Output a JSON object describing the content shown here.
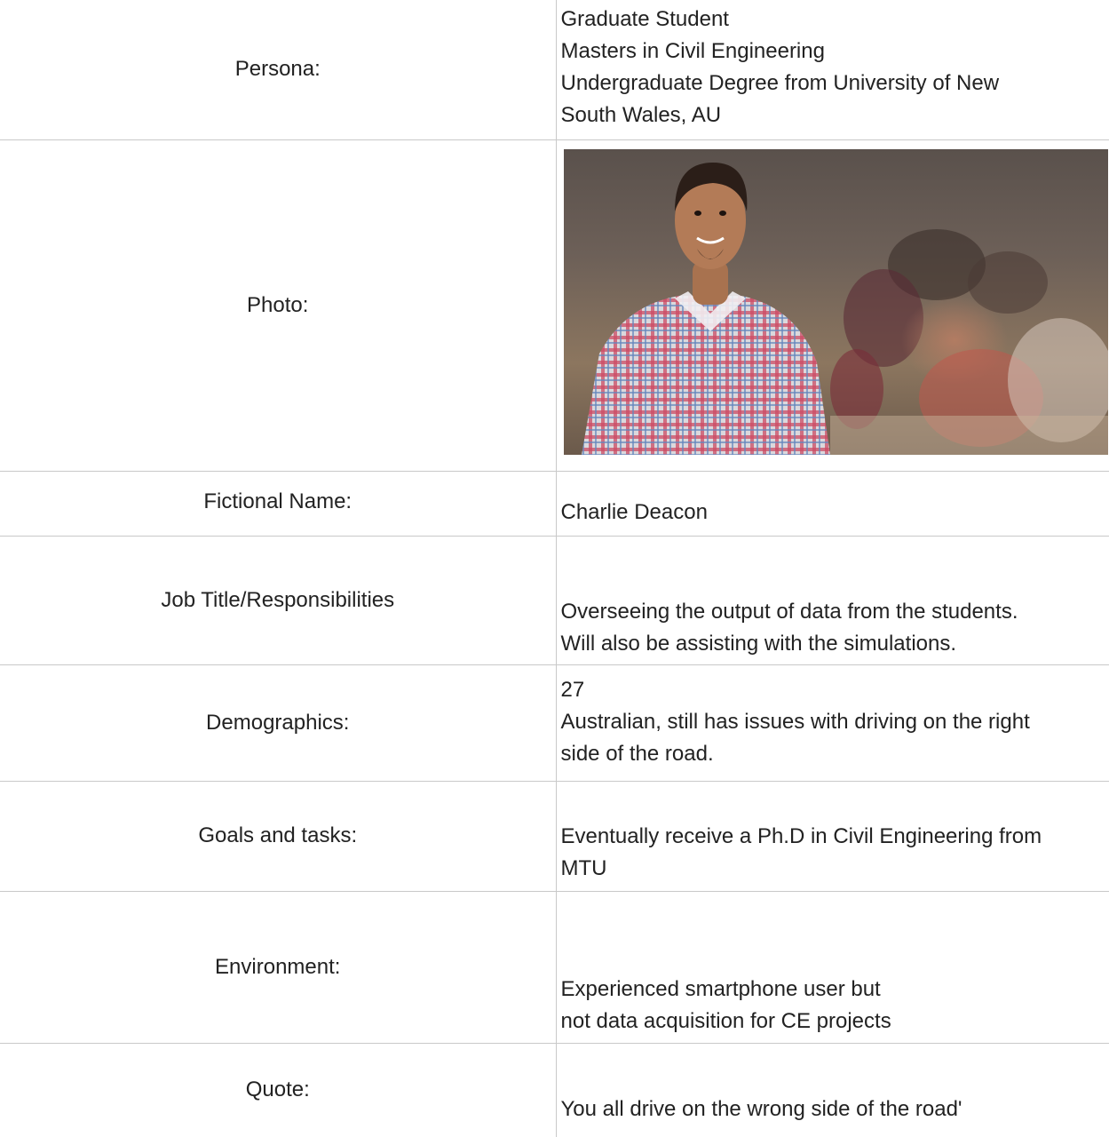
{
  "rows": [
    {
      "label": "Persona:",
      "lines": [
        "Graduate Student",
        "Masters in Civil Engineering",
        "Undergraduate Degree from University of New",
        "South Wales, AU"
      ]
    },
    {
      "label": "Photo:",
      "photo": {
        "icon": "person-photo",
        "bg": "#5b524d",
        "shirt_red": "#d9506a",
        "shirt_blue": "#6b8fc9"
      }
    },
    {
      "label": "Fictional Name:",
      "lines": [
        "Charlie Deacon"
      ]
    },
    {
      "label": "Job Title/Responsibilities",
      "lines": [
        "Overseeing the output of data from the students.",
        "Will also be assisting with the simulations."
      ]
    },
    {
      "label": "Demographics:",
      "lines": [
        "27",
        "Australian, still has issues with driving on the right",
        "side of the road."
      ]
    },
    {
      "label": "Goals and tasks:",
      "lines": [
        "Eventually receive a Ph.D in Civil Engineering from",
        "MTU"
      ]
    },
    {
      "label": "Environment:",
      "lines": [
        "Experienced smartphone user but",
        "not data acquisition for CE projects"
      ]
    },
    {
      "label": "Quote:",
      "lines": [
        "You all drive on the wrong side of the road'"
      ]
    }
  ],
  "colors": {
    "border": "#c9c9c9",
    "text": "#222222"
  }
}
